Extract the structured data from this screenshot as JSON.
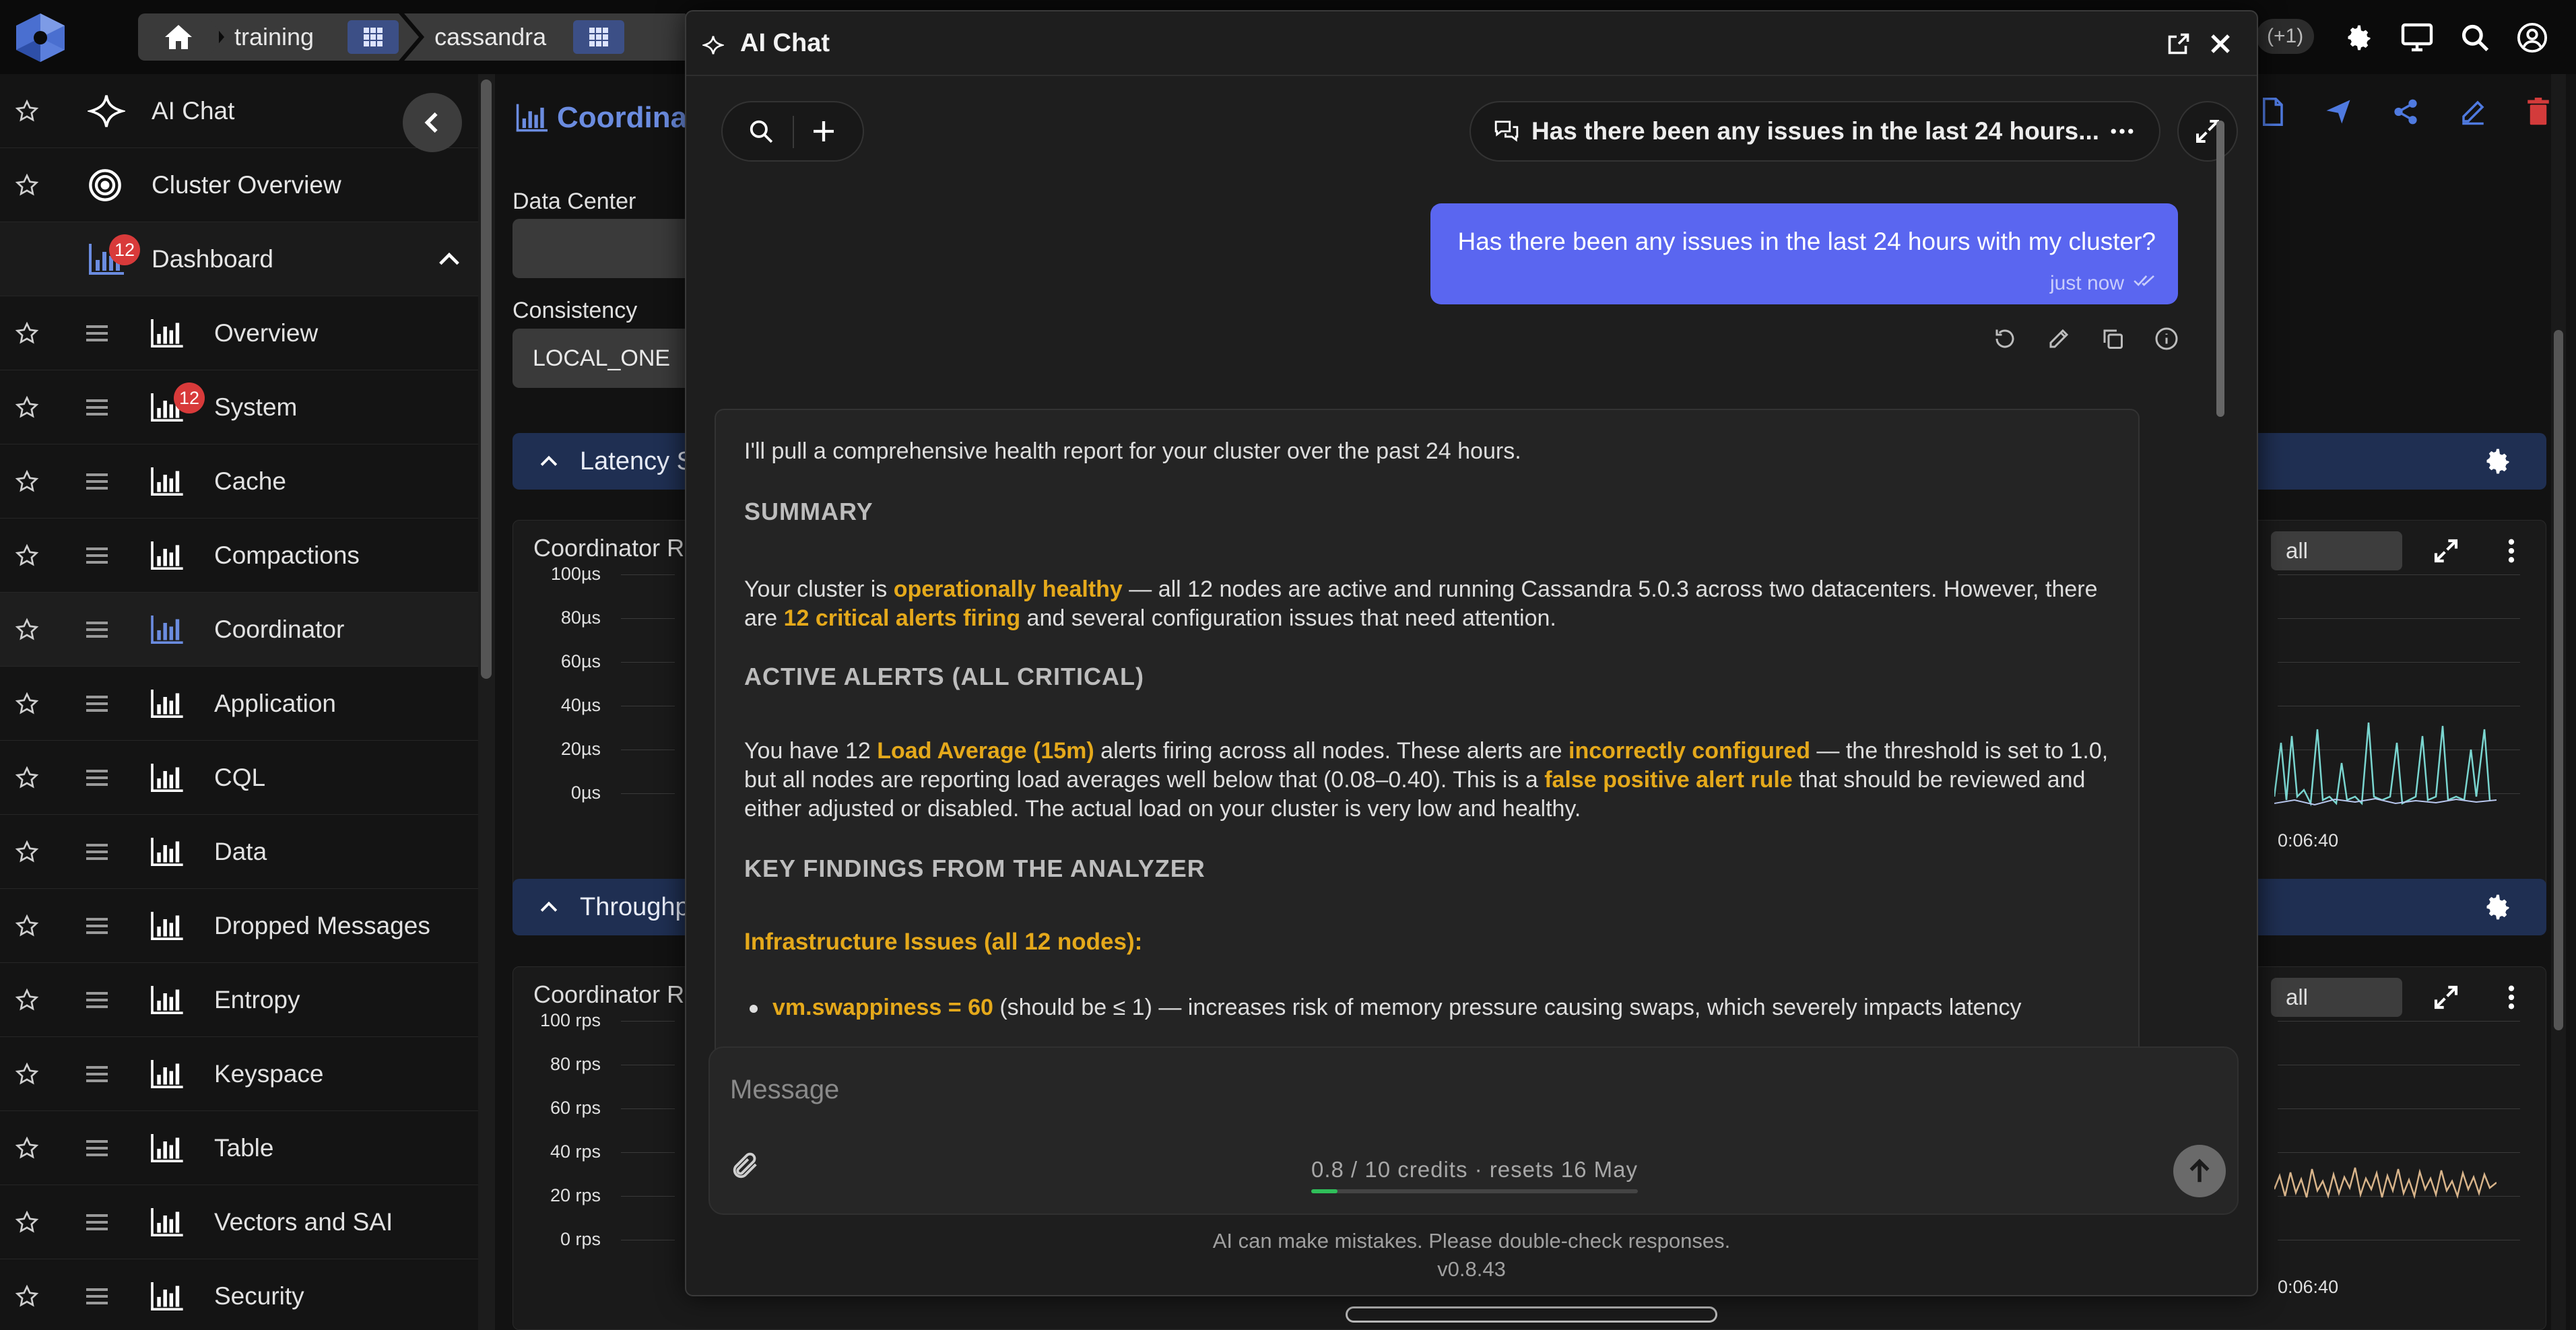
{
  "breadcrumbs": [
    "training",
    "cassandra"
  ],
  "topbar": {
    "plus_count": "(+1)"
  },
  "sidebar": {
    "top_items": [
      {
        "label": "AI Chat",
        "icon": "sparkle-icon"
      },
      {
        "label": "Cluster Overview",
        "icon": "target-icon"
      },
      {
        "label": "Dashboard",
        "icon": "chart-bars-icon",
        "badge": "12"
      }
    ],
    "items": [
      {
        "label": "Overview"
      },
      {
        "label": "System",
        "badge": "12"
      },
      {
        "label": "Cache"
      },
      {
        "label": "Compactions"
      },
      {
        "label": "Coordinator",
        "active": true
      },
      {
        "label": "Application"
      },
      {
        "label": "CQL"
      },
      {
        "label": "Data"
      },
      {
        "label": "Dropped Messages"
      },
      {
        "label": "Entropy"
      },
      {
        "label": "Keyspace"
      },
      {
        "label": "Table"
      },
      {
        "label": "Vectors and SAI"
      },
      {
        "label": "Security"
      }
    ]
  },
  "dashboard": {
    "title": "Coordina",
    "data_center_label": "Data Center",
    "consistency_label": "Consistency",
    "consistency_value": "LOCAL_ONE",
    "latency_section": "Latency S",
    "throughput_section": "Throughp",
    "latency_panel_title": "Coordinator R",
    "throughput_panel_title": "Coordinator R",
    "latency_ticks": [
      "100µs",
      "80µs",
      "60µs",
      "40µs",
      "20µs",
      "0µs"
    ],
    "throughput_ticks": [
      "100 rps",
      "80 rps",
      "60 rps",
      "40 rps",
      "20 rps",
      "0 rps"
    ],
    "filter_value": "all",
    "x_time_label": "0:06:40"
  },
  "chat": {
    "title": "AI Chat",
    "conversation_title": "Has there been any issues in the last 24 hours...",
    "user_message": "Has there been any issues in the last 24 hours with my cluster?",
    "user_time": "just now",
    "reply": {
      "intro": "I'll pull a comprehensive health report for your cluster over the past 24 hours.",
      "summary_heading": "SUMMARY",
      "summary_1": "Your cluster is ",
      "summary_hl_1": "operationally healthy",
      "summary_2": " — all 12 nodes are active and running Cassandra 5.0.3 across two datacenters. However, there are ",
      "summary_hl_2": "12 critical alerts firing",
      "summary_3": " and several configuration issues that need attention.",
      "alerts_heading": "ACTIVE ALERTS (ALL CRITICAL)",
      "alerts_1": "You have 12 ",
      "alerts_hl_1": "Load Average (15m)",
      "alerts_2": " alerts firing across all nodes. These alerts are ",
      "alerts_hl_2": "incorrectly configured",
      "alerts_3": " — the threshold is set to 1.0, but all nodes are reporting load averages well below that (0.08–0.40). This is a ",
      "alerts_hl_3": "false positive alert rule",
      "alerts_4": " that should be reviewed and either adjusted or disabled. The actual load on your cluster is very low and healthy.",
      "findings_heading": "KEY FINDINGS FROM THE ANALYZER",
      "infra_heading": "Infrastructure Issues (all 12 nodes):",
      "bullet_hl": "vm.swappiness = 60",
      "bullet_text": " (should be ≤ 1) — increases risk of memory pressure causing swaps, which severely impacts latency"
    },
    "composer": {
      "placeholder": "Message",
      "credits_text": "0.8 / 10 credits · resets 16 May",
      "credits_fraction": 0.08
    },
    "disclaimer": "AI can make mistakes. Please double-check responses.",
    "version": "v0.8.43"
  },
  "colors": {
    "accent": "#5a66f0",
    "highlight": "#e5a91b",
    "badge": "#d83a3a",
    "link_blue": "#6b8ce0"
  }
}
